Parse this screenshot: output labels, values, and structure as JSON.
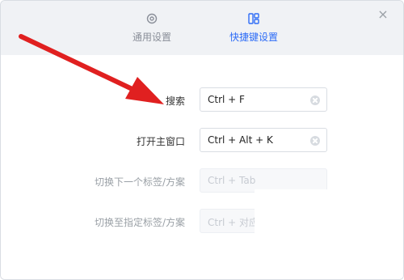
{
  "tabs": [
    {
      "label": "通用设置",
      "icon": "gear-icon"
    },
    {
      "label": "快捷键设置",
      "icon": "layout-icon",
      "active": true
    }
  ],
  "rows": [
    {
      "label": "搜索",
      "value": "Ctrl + F",
      "enabled": true
    },
    {
      "label": "打开主窗口",
      "value": "Ctrl + Alt + K",
      "enabled": true
    },
    {
      "label": "切换下一个标签/方案",
      "value": "Ctrl + Tab",
      "enabled": false
    },
    {
      "label": "切换至指定标签/方案",
      "value": "Ctrl + 对应",
      "enabled": false
    }
  ],
  "colors": {
    "accent": "#2d6cf6",
    "annotation": "#e02020"
  }
}
